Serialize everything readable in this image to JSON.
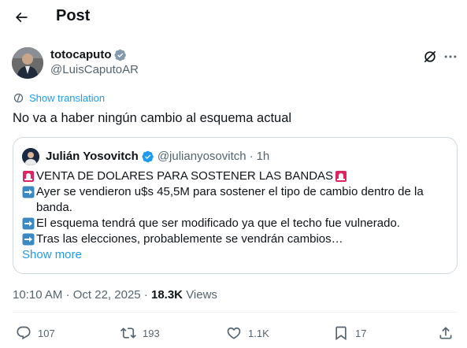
{
  "header": {
    "title": "Post",
    "back_icon": "arrow-left-icon"
  },
  "author": {
    "name": "totocaputo",
    "handle": "@LuisCaputoAR",
    "verified_color": "#829aab"
  },
  "translate_label": "Show translation",
  "tweet_text": "No va a haber ningún cambio al esquema actual",
  "quote": {
    "name": "Julián Yosovitch",
    "handle": "@julianyosovitch",
    "separator": "·",
    "age": "1h",
    "verified_color": "#1d9bf0",
    "lines": [
      {
        "emoji": "police-light",
        "text": "VENTA DE DOLARES PARA SOSTENER LAS BANDAS",
        "trail_emoji": "police-light"
      },
      {
        "emoji": "right-arrow",
        "text": "Ayer se vendieron u$s 45,5M para sostener el tipo de cambio dentro de la banda."
      },
      {
        "emoji": "right-arrow",
        "text": "El esquema tendrá que ser modificado ya que el techo fue vulnerado."
      },
      {
        "emoji": "right-arrow",
        "text": "Tras las elecciones, probablemente se vendrán cambios…"
      }
    ],
    "show_more": "Show more"
  },
  "meta": {
    "time": "10:10 AM",
    "dot": "·",
    "date": "Oct 22, 2025",
    "views_count": "18.3K",
    "views_label": "Views"
  },
  "actions": {
    "replies": "107",
    "reposts": "193",
    "likes": "1.1K",
    "bookmarks": "17"
  },
  "colors": {
    "accent": "#1d9bf0",
    "muted": "#536471",
    "text": "#0f1419",
    "border": "#cfd9de"
  }
}
